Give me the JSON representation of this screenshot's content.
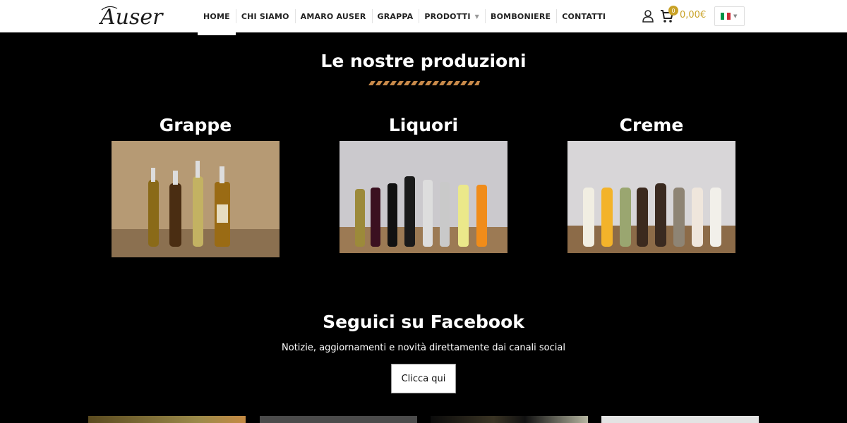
{
  "header": {
    "logo_text": "Auser",
    "nav": [
      {
        "label": "HOME",
        "active": true
      },
      {
        "label": "CHI SIAMO"
      },
      {
        "label": "AMARO AUSER"
      },
      {
        "label": "GRAPPA"
      },
      {
        "label": "PRODOTTI",
        "has_dropdown": true
      },
      {
        "label": "BOMBONIERE"
      },
      {
        "label": "CONTATTI"
      }
    ],
    "icons": {
      "account": "user-icon",
      "cart": "cart-icon",
      "dropdown": "chevron-down-icon"
    },
    "cart_count": "0",
    "cart_total": "0,00€",
    "language": {
      "flag": "italy-flag",
      "colors": [
        "#009246",
        "#ffffff",
        "#ce2b37"
      ]
    }
  },
  "productions": {
    "title": "Le nostre produzioni",
    "categories": [
      {
        "label": "Grappe",
        "image": "grappe-bottles-photo"
      },
      {
        "label": "Liquori",
        "image": "liquori-bottles-photo"
      },
      {
        "label": "Creme",
        "image": "creme-bottles-photo"
      }
    ]
  },
  "facebook": {
    "title": "Seguici su Facebook",
    "subtitle": "Notizie, aggiornamenti e novità direttamente dai canali social",
    "button_label": "Clicca qui"
  },
  "colors": {
    "accent": "#c9a227",
    "background": "#000000",
    "header_bg": "#ffffff"
  }
}
